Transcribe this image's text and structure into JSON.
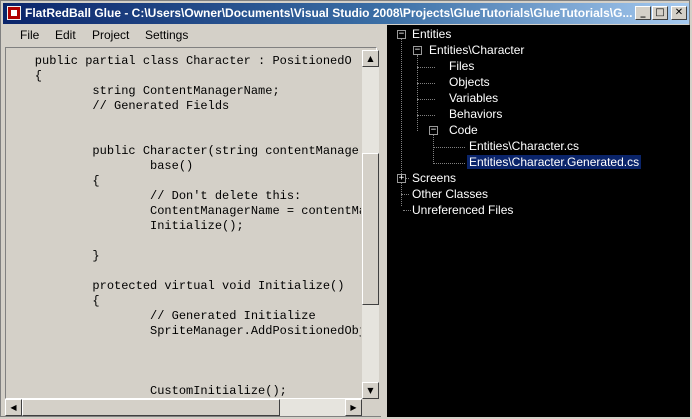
{
  "window": {
    "title": "FlatRedBall Glue - C:\\Users\\Owner\\Documents\\Visual Studio 2008\\Projects\\GlueTutorials\\GlueTutorials\\G...",
    "minimize_glyph": "_",
    "maximize_glyph": "□",
    "close_glyph": "✕",
    "app_icon": "flatredball-app-icon"
  },
  "menu": {
    "items": [
      {
        "label": "File"
      },
      {
        "label": "Edit"
      },
      {
        "label": "Project"
      },
      {
        "label": "Settings"
      }
    ]
  },
  "editor": {
    "lines": [
      "    public partial class Character : PositionedO",
      "    {",
      "            string ContentManagerName;",
      "            // Generated Fields",
      "",
      "",
      "            public Character(string contentManage",
      "                    base()",
      "            {",
      "                    // Don't delete this:",
      "                    ContentManagerName = contentMa",
      "                    Initialize();",
      "",
      "            }",
      "",
      "            protected virtual void Initialize()",
      "            {",
      "                    // Generated Initialize",
      "                    SpriteManager.AddPositionedObj",
      "",
      "",
      "",
      "                    CustomInitialize();"
    ],
    "scroll_up_glyph": "▲",
    "scroll_down_glyph": "▼",
    "scroll_left_glyph": "◀",
    "scroll_right_glyph": "▶"
  },
  "tree": {
    "entities": {
      "label": "Entities",
      "expander": "−"
    },
    "character": {
      "label": "Entities\\Character",
      "expander": "−"
    },
    "files": {
      "label": "Files"
    },
    "objects": {
      "label": "Objects"
    },
    "variables": {
      "label": "Variables"
    },
    "behaviors": {
      "label": "Behaviors"
    },
    "code": {
      "label": "Code",
      "expander": "−"
    },
    "character_cs": {
      "label": "Entities\\Character.cs"
    },
    "character_generated_cs": {
      "label": "Entities\\Character.Generated.cs",
      "selected": true
    },
    "screens": {
      "label": "Screens",
      "expander": "+"
    },
    "other_classes": {
      "label": "Other Classes"
    },
    "unreferenced_files": {
      "label": "Unreferenced Files"
    }
  },
  "colors": {
    "title_gradient_start": "#0a246a",
    "tree_background": "#000000",
    "selection": "#0a246a",
    "editor_background": "#d4d0c8"
  }
}
